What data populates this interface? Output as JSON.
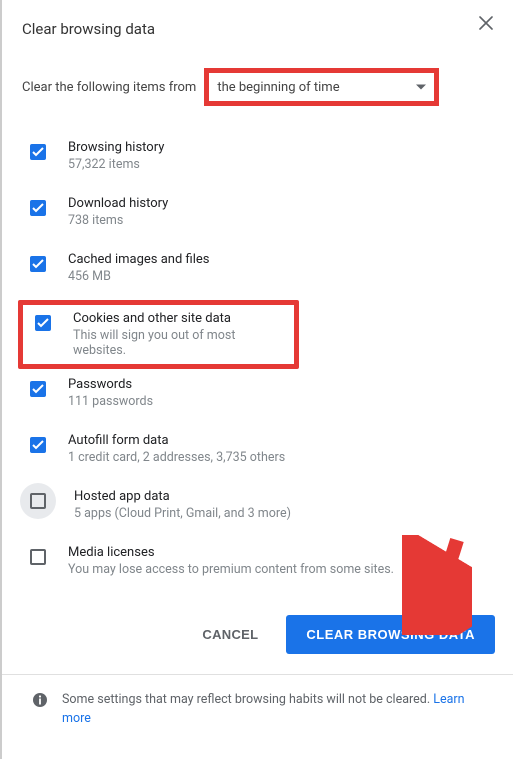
{
  "title": "Clear browsing data",
  "timerange": {
    "prefix": "Clear the following items from",
    "selected": "the beginning of time"
  },
  "items": {
    "browsing": {
      "label": "Browsing history",
      "sub": "57,322 items",
      "checked": true
    },
    "download": {
      "label": "Download history",
      "sub": "738 items",
      "checked": true
    },
    "cached": {
      "label": "Cached images and files",
      "sub": "456 MB",
      "checked": true
    },
    "cookies": {
      "label": "Cookies and other site data",
      "sub": "This will sign you out of most websites.",
      "checked": true
    },
    "passwords": {
      "label": "Passwords",
      "sub": "111 passwords",
      "checked": true
    },
    "autofill": {
      "label": "Autofill form data",
      "sub": "1 credit card, 2 addresses, 3,735 others",
      "checked": true
    },
    "hosted": {
      "label": "Hosted app data",
      "sub": "5 apps (Cloud Print, Gmail, and 3 more)",
      "checked": false
    },
    "media": {
      "label": "Media licenses",
      "sub": "You may lose access to premium content from some sites.",
      "checked": false
    }
  },
  "actions": {
    "cancel": "CANCEL",
    "clear": "CLEAR BROWSING DATA"
  },
  "footer": {
    "text": "Some settings that may reflect browsing habits will not be cleared. ",
    "learn_more": "Learn more"
  }
}
